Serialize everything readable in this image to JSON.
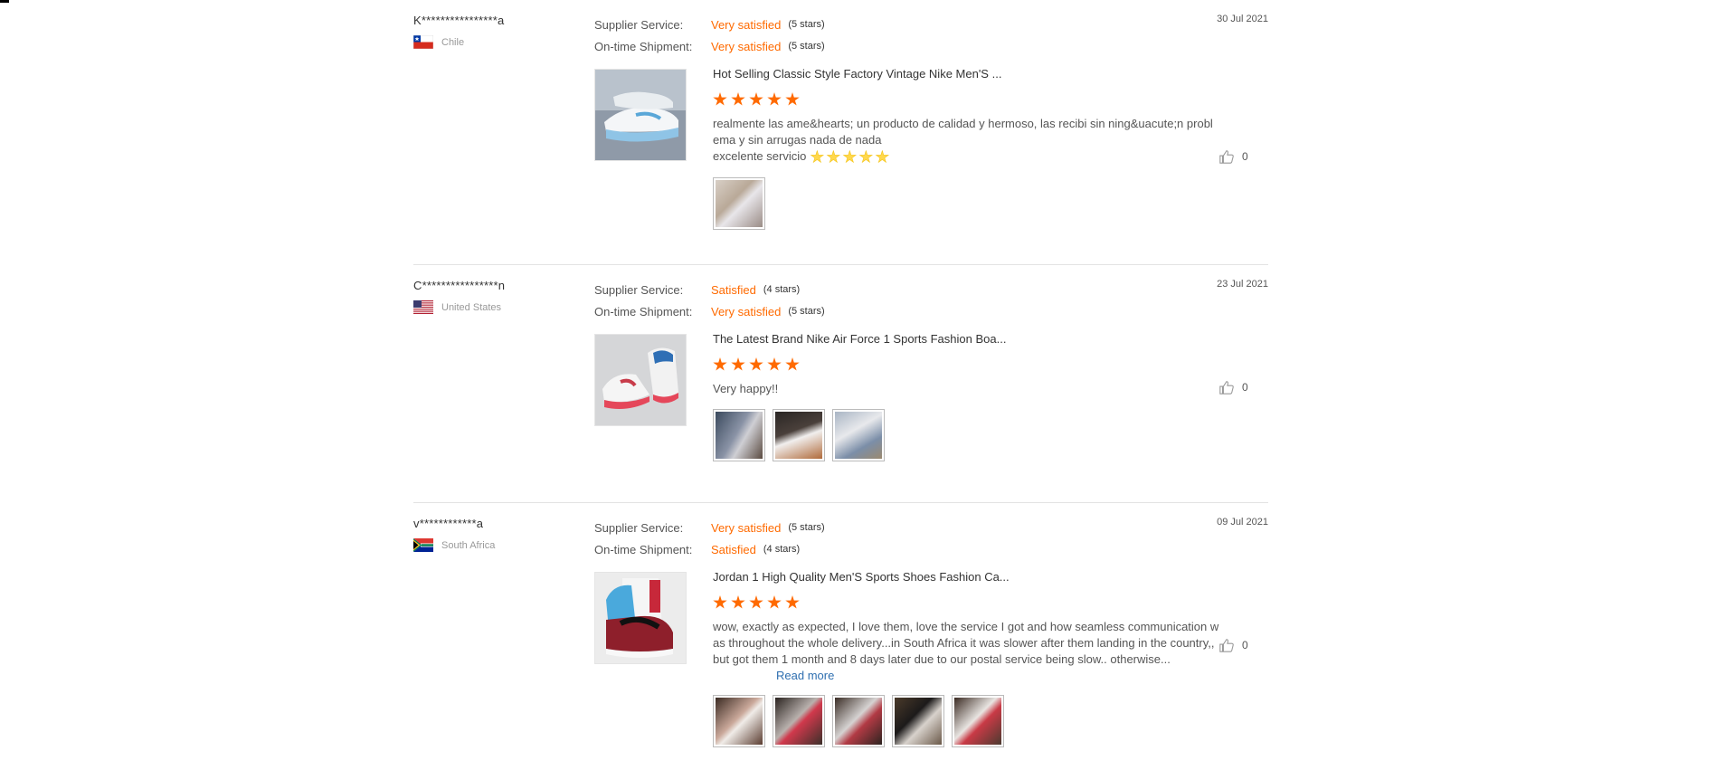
{
  "reviews": [
    {
      "buyer": "K****************a",
      "country": "Chile",
      "supplier_label": "Supplier Service:",
      "supplier_value": "Very satisfied",
      "supplier_stars": "(5 stars)",
      "shipment_label": "On-time Shipment:",
      "shipment_value": "Very satisfied",
      "shipment_stars": "(5 stars)",
      "date": "30 Jul 2021",
      "product_title": "Hot Selling Classic Style Factory Vintage Nike Men'S ...",
      "rating": 5,
      "feedback": "realmente las ame&hearts; un producto de calidad y hermoso, las recibi sin ning&uacute;n problema y sin arrugas nada de nada",
      "feedback_line2": "excelente servicio",
      "likes": "0"
    },
    {
      "buyer": "C****************n",
      "country": "United States",
      "supplier_label": "Supplier Service:",
      "supplier_value": "Satisfied",
      "supplier_stars": "(4 stars)",
      "shipment_label": "On-time Shipment:",
      "shipment_value": "Very satisfied",
      "shipment_stars": "(5 stars)",
      "date": "23 Jul 2021",
      "product_title": "The Latest Brand Nike Air Force 1 Sports Fashion Boa...",
      "rating": 5,
      "feedback": "Very happy!!",
      "likes": "0"
    },
    {
      "buyer": "v************a",
      "country": "South Africa",
      "supplier_label": "Supplier Service:",
      "supplier_value": "Very satisfied",
      "supplier_stars": "(5 stars)",
      "shipment_label": "On-time Shipment:",
      "shipment_value": "Satisfied",
      "shipment_stars": "(4 stars)",
      "date": "09 Jul 2021",
      "product_title": "Jordan 1 High Quality Men'S Sports Shoes Fashion Ca...",
      "rating": 5,
      "feedback": "wow, exactly as expected, I love them, love the service I got and how seamless communication was throughout the whole delivery...in South Africa it was slower after them landing in the country,,but got them 1 month and 8 days later due to our postal service being slow.. otherwise...",
      "read_more": "Read more",
      "likes": "0"
    }
  ],
  "colors": {
    "accent": "#ff6a00",
    "link": "#2f6fb0"
  }
}
